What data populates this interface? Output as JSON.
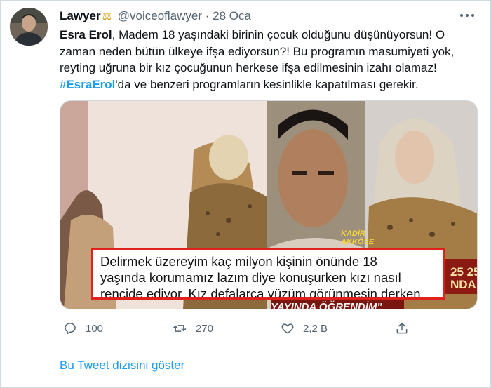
{
  "tweet": {
    "author_name": "Lawyer",
    "author_badge": "⚖",
    "handle": "@voiceoflawyer",
    "separator": "·",
    "date": "28 Oca",
    "text_mention": "Esra Erol",
    "text_part1": ", Madem 18 yaşındaki birinin çocuk olduğunu düşünüyorsun! O zaman neden bütün ülkeye ifşa ediyorsun?! Bu programın masumiyeti yok, reyting uğruna bir kız çocuğunun herkese ifşa edilmesinin izahı olamaz!",
    "hashtag": "#EsraErol",
    "text_part2": "'da ve benzeri programların kesinlikle kapatılması gerekir."
  },
  "media": {
    "caption_line1": "Delirmek üzereyim kaç milyon kişinin önünde 18",
    "caption_line2": "yaşında korumamız lazım diye konuşurken kızı nasıl",
    "caption_line3": "rencide ediyor. Kız defalarca yüzüm görünmesin derken",
    "name_tag_line1": "KADİR",
    "name_tag_line2": "AKKÖSE",
    "banner_line1": "25 25",
    "banner_line2": "NDA",
    "banner_bottom": "YAYINDA ÖĞRENDİM\""
  },
  "actions": {
    "reply_icon": "reply-icon",
    "reply_count": "100",
    "retweet_icon": "retweet-icon",
    "retweet_count": "270",
    "like_icon": "heart-icon",
    "like_count": "2,2 B",
    "share_icon": "share-icon"
  },
  "thread_link": "Bu Tweet dizisini göster",
  "colors": {
    "link": "#1d9bf0",
    "secondary_text": "#536471",
    "caption_border": "#e0201c"
  }
}
